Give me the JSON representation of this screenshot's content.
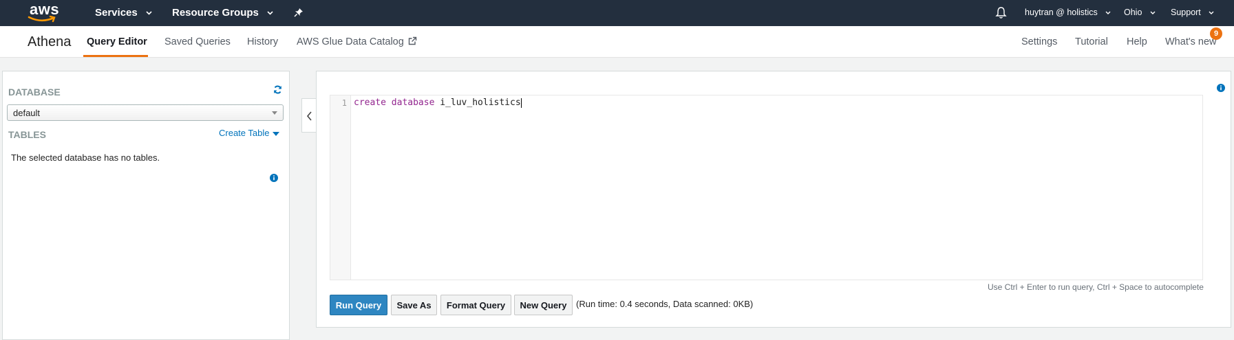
{
  "topnav": {
    "logo_text": "aws",
    "services_label": "Services",
    "resource_groups_label": "Resource Groups",
    "user_label": "huytran @ holistics",
    "region_label": "Ohio",
    "support_label": "Support"
  },
  "subnav": {
    "brand": "Athena",
    "tabs": [
      {
        "label": "Query Editor",
        "active": true
      },
      {
        "label": "Saved Queries"
      },
      {
        "label": "History"
      },
      {
        "label": "AWS Glue Data Catalog"
      }
    ],
    "right_links": [
      "Settings",
      "Tutorial",
      "Help",
      "What's new"
    ],
    "whats_new_badge": "9"
  },
  "sidebar": {
    "database_heading": "DATABASE",
    "selected_database": "default",
    "tables_heading": "TABLES",
    "create_table_label": "Create Table",
    "empty_message": "The selected database has no tables."
  },
  "editor": {
    "line_number": "1",
    "code_keyword_1": "create",
    "code_keyword_2": "database",
    "code_identifier": "i_luv_holistics",
    "hint": "Use Ctrl + Enter to run query, Ctrl + Space to autocomplete"
  },
  "actions": {
    "run_query": "Run Query",
    "save_as": "Save As",
    "format_query": "Format Query",
    "new_query": "New Query",
    "status": "(Run time: 0.4 seconds, Data scanned: 0KB)"
  },
  "colors": {
    "topnav_bg": "#232f3e",
    "accent": "#ec7211",
    "link": "#0073bb",
    "primary_button": "#2e86c1",
    "keyword": "#93268f"
  },
  "icons": [
    "smile-arrow-icon",
    "chevron-down-icon",
    "pin-icon",
    "bell-icon",
    "external-link-icon",
    "refresh-icon",
    "info-icon",
    "chevron-left-icon"
  ]
}
